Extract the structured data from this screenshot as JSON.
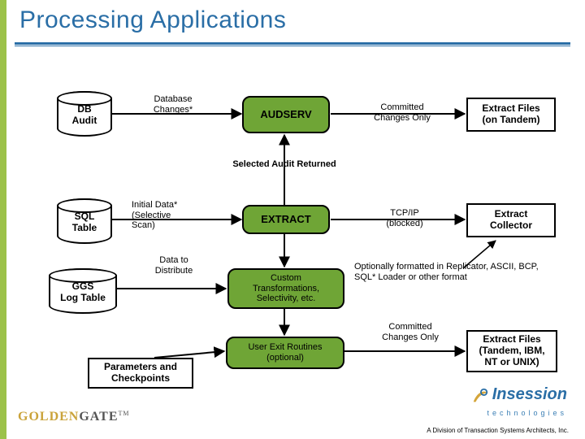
{
  "title": "Processing Applications",
  "cylinders": {
    "db_audit": "DB\nAudit",
    "sql_table": "SQL\nTable",
    "ggs_log": "GGS\nLog Table"
  },
  "edge_labels": {
    "db_changes": "Database\nChanges*",
    "committed1": "Committed\nChanges Only",
    "selected_audit": "Selected Audit Returned",
    "initial_data": "Initial Data*\n(Selective\nScan)",
    "tcpip": "TCP/IP\n(blocked)",
    "data_to_dist": "Data to\nDistribute",
    "format_note": "Optionally formatted in Replicator, ASCII, BCP,\nSQL* Loader or other format",
    "committed2": "Committed\nChanges Only"
  },
  "proc": {
    "audserv": "AUDSERV",
    "extract": "EXTRACT",
    "custom": "Custom\nTransformations,\nSelectivity, etc.",
    "user_exit": "User Exit Routines\n(optional)"
  },
  "boxes": {
    "extract_files1": "Extract Files\n(on Tandem)",
    "extract_collector": "Extract\nCollector",
    "params": "Parameters and\nCheckpoints",
    "extract_files2": "Extract Files\n(Tandem, IBM,\nNT or UNIX)"
  },
  "footer": {
    "goldengate_gold": "GOLDEN",
    "goldengate_gate": "GATE",
    "tm": "TM",
    "insession_brand": "Insession",
    "insession_tech": "technologies",
    "footnote": "A Division of Transaction Systems Architects, Inc."
  }
}
